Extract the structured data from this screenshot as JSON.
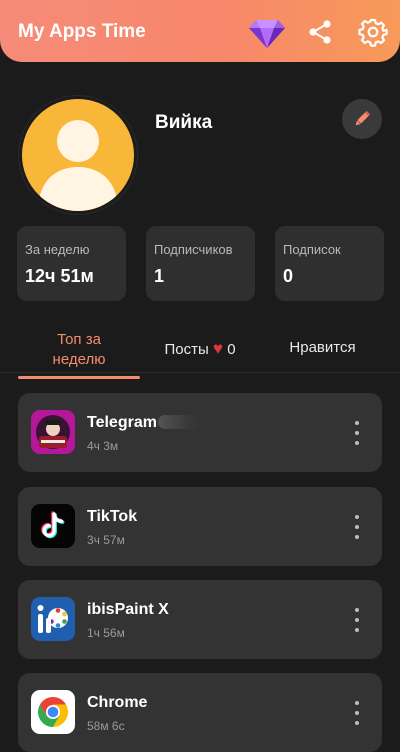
{
  "header": {
    "title": "My Apps Time",
    "icons": [
      "diamond-icon",
      "share-icon",
      "gear-icon"
    ]
  },
  "profile": {
    "name": "Вийка"
  },
  "stats": [
    {
      "label": "За неделю",
      "value": "12ч 51м"
    },
    {
      "label": "Подписчиков",
      "value": "1"
    },
    {
      "label": "Подписок",
      "value": "0"
    }
  ],
  "tabs": {
    "top_week_line1": "Топ за",
    "top_week_line2": "неделю",
    "posts_label": "Посты",
    "posts_count": "0",
    "likes_label": "Нравится"
  },
  "apps": [
    {
      "name": "Telegram",
      "time": "4ч 3м"
    },
    {
      "name": "TikTok",
      "time": "3ч 57м"
    },
    {
      "name": "ibisPaint X",
      "time": "1ч 56м"
    },
    {
      "name": "Chrome",
      "time": "58м 6с"
    }
  ],
  "colors": {
    "accent": "#f48d6e",
    "header_start": "#f58b78",
    "header_end": "#f79a59",
    "avatar_bg": "#f8b738",
    "heart": "#e0353a"
  }
}
